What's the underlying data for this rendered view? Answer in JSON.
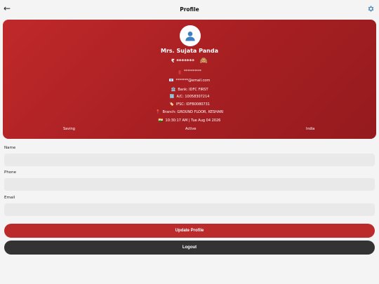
{
  "header": {
    "back_icon": "←",
    "title": "Profile",
    "settings_icon": "⚙️"
  },
  "profile": {
    "avatar_icon": "👤",
    "name": "Mrs. Sujata Panda",
    "balance_masked": "₹ *******",
    "eye_icon": "🙈",
    "phone_masked": "**********",
    "email_icon": "📧",
    "email_masked": "*******@email.com",
    "bank_icon": "🏦",
    "bank": "Bank: IDFC FIRST",
    "account_icon": "🔢",
    "account": "A/C: 10058307214",
    "ifsc_icon": "🏷️",
    "ifsc": "IFSC: IDFB0080731",
    "branch_icon": "📍",
    "branch": "Branch: GROUND FLOOR, KESHARI",
    "datetime_icon": "🇮🇳",
    "datetime": "10:30:17 AM | Tue Aug 04 2026",
    "account_type": "Saving",
    "status": "Active",
    "country": "India"
  },
  "form": {
    "name_label": "Name",
    "name_value": "",
    "phone_label": "Phone",
    "phone_value": "",
    "email_label": "Email",
    "email_value": ""
  },
  "actions": {
    "update_label": "Update Profile",
    "logout_label": "Logout"
  }
}
